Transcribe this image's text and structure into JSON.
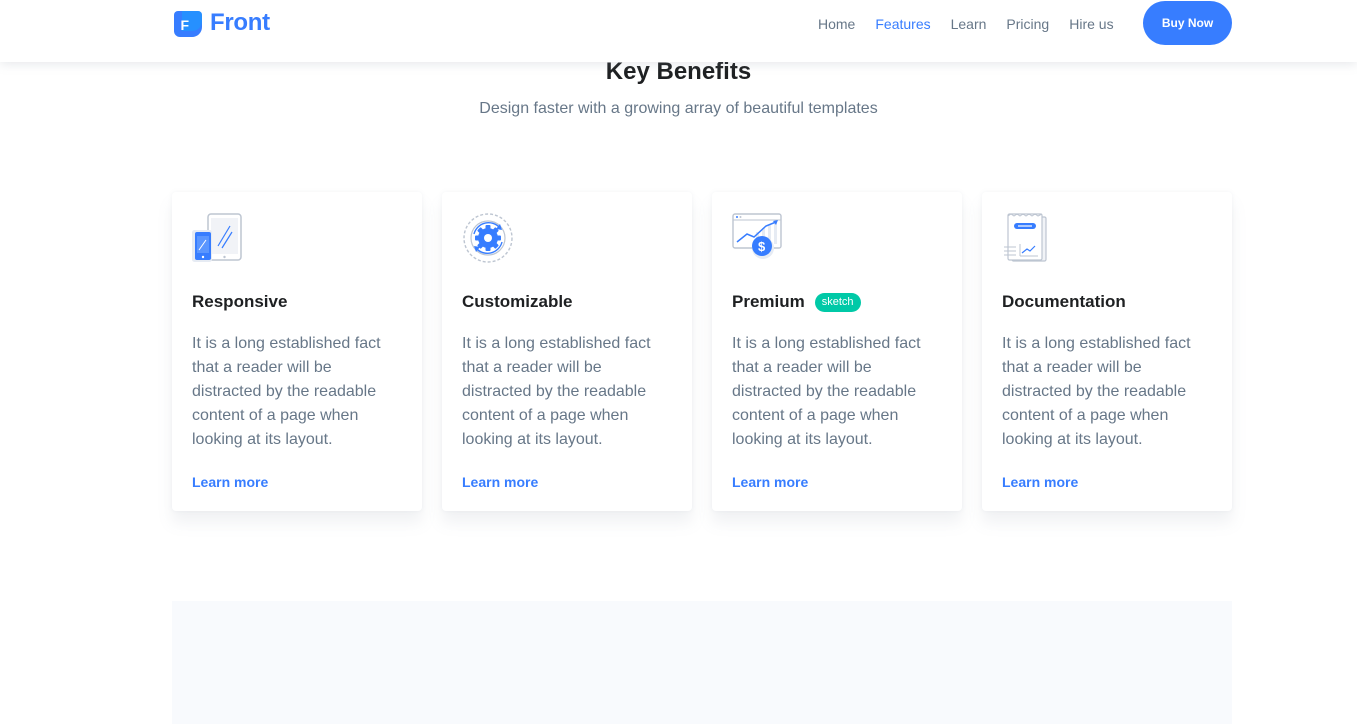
{
  "header": {
    "brand": {
      "mark_letter": "F",
      "name": "Front"
    },
    "nav": [
      {
        "label": "Home",
        "active": false
      },
      {
        "label": "Features",
        "active": true
      },
      {
        "label": "Learn",
        "active": false
      },
      {
        "label": "Pricing",
        "active": false
      },
      {
        "label": "Hire us",
        "active": false
      }
    ],
    "cta_label": "Buy Now"
  },
  "section": {
    "title": "Key Benefits",
    "subtitle": "Design faster with a growing array of beautiful templates"
  },
  "cards": [
    {
      "icon": "responsive-devices-icon",
      "title": "Responsive",
      "badge": "",
      "text": "It is a long established fact that a reader will be distracted by the readable content of a page when looking at its layout.",
      "link": "Learn more"
    },
    {
      "icon": "gear-customize-icon",
      "title": "Customizable",
      "badge": "",
      "text": "It is a long established fact that a reader will be distracted by the readable content of a page when looking at its layout.",
      "link": "Learn more"
    },
    {
      "icon": "premium-chart-dollar-icon",
      "title": "Premium",
      "badge": "sketch",
      "text": "It is a long established fact that a reader will be distracted by the readable content of a page when looking at its layout.",
      "link": "Learn more"
    },
    {
      "icon": "documentation-icon",
      "title": "Documentation",
      "badge": "",
      "text": "It is a long established fact that a reader will be distracted by the readable content of a page when looking at its layout.",
      "link": "Learn more"
    }
  ],
  "colors": {
    "primary": "#377dff",
    "text_dark": "#1e2022",
    "text_muted": "#677788",
    "badge": "#00c9a7",
    "panel_bg": "#f8fafd"
  }
}
